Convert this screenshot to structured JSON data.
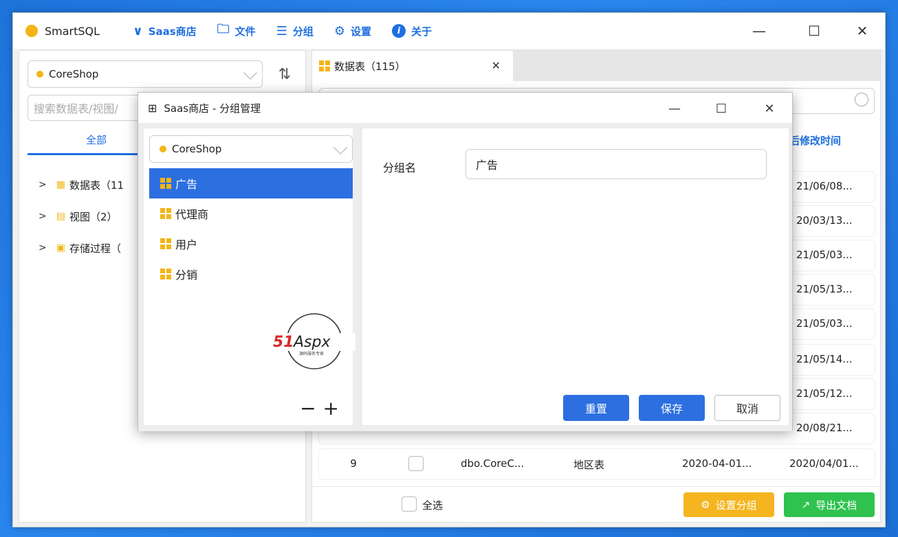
{
  "titlebar": {
    "app_name": "SmartSQL",
    "menu": [
      {
        "label": "Saas商店",
        "icon": "chevron-down-icon"
      },
      {
        "label": "文件",
        "icon": "folder-icon"
      },
      {
        "label": "分组",
        "icon": "list-icon"
      },
      {
        "label": "设置",
        "icon": "gear-icon"
      },
      {
        "label": "关于",
        "icon": "info-icon"
      }
    ]
  },
  "left": {
    "db_selected": "CoreShop",
    "search_placeholder": "搜索数据表/视图/",
    "tab_all": "全部",
    "tree": [
      {
        "label": "数据表（11"
      },
      {
        "label": "视图（2）"
      },
      {
        "label": "存储过程（"
      }
    ]
  },
  "right": {
    "tab_label": "数据表（115）",
    "col_last_modified": "后修改时间",
    "rows": [
      {
        "num": "",
        "modified": "21/06/08..."
      },
      {
        "num": "",
        "modified": "20/03/13..."
      },
      {
        "num": "",
        "modified": "21/05/03..."
      },
      {
        "num": "",
        "modified": "21/05/13..."
      },
      {
        "num": "",
        "modified": "21/05/03..."
      },
      {
        "num": "",
        "modified": "21/05/14..."
      },
      {
        "num": "",
        "modified": "21/05/12..."
      },
      {
        "num": "",
        "modified": "20/08/21..."
      },
      {
        "num": "9",
        "name": "dbo.CoreC...",
        "desc": "地区表",
        "created": "2020-04-01...",
        "modified": "2020/04/01..."
      }
    ],
    "select_all": "全选",
    "btn_set_group": "设置分组",
    "btn_export": "导出文档"
  },
  "dialog": {
    "title": "Saas商店 - 分组管理",
    "db_selected": "CoreShop",
    "groups": [
      "广告",
      "代理商",
      "用户",
      "分销"
    ],
    "active_group": "广告",
    "field_label": "分组名",
    "field_value": "广告",
    "btn_reset": "重置",
    "btn_save": "保存",
    "btn_cancel": "取消",
    "minus": "−",
    "plus": "+"
  },
  "logo": {
    "text": "51Aspx",
    "subtext": "源码服务专家"
  },
  "colors": {
    "accent": "#2d6fe0",
    "warn": "#f5b520",
    "ok": "#2fc24e",
    "icon_yellow": "#f3b516"
  }
}
